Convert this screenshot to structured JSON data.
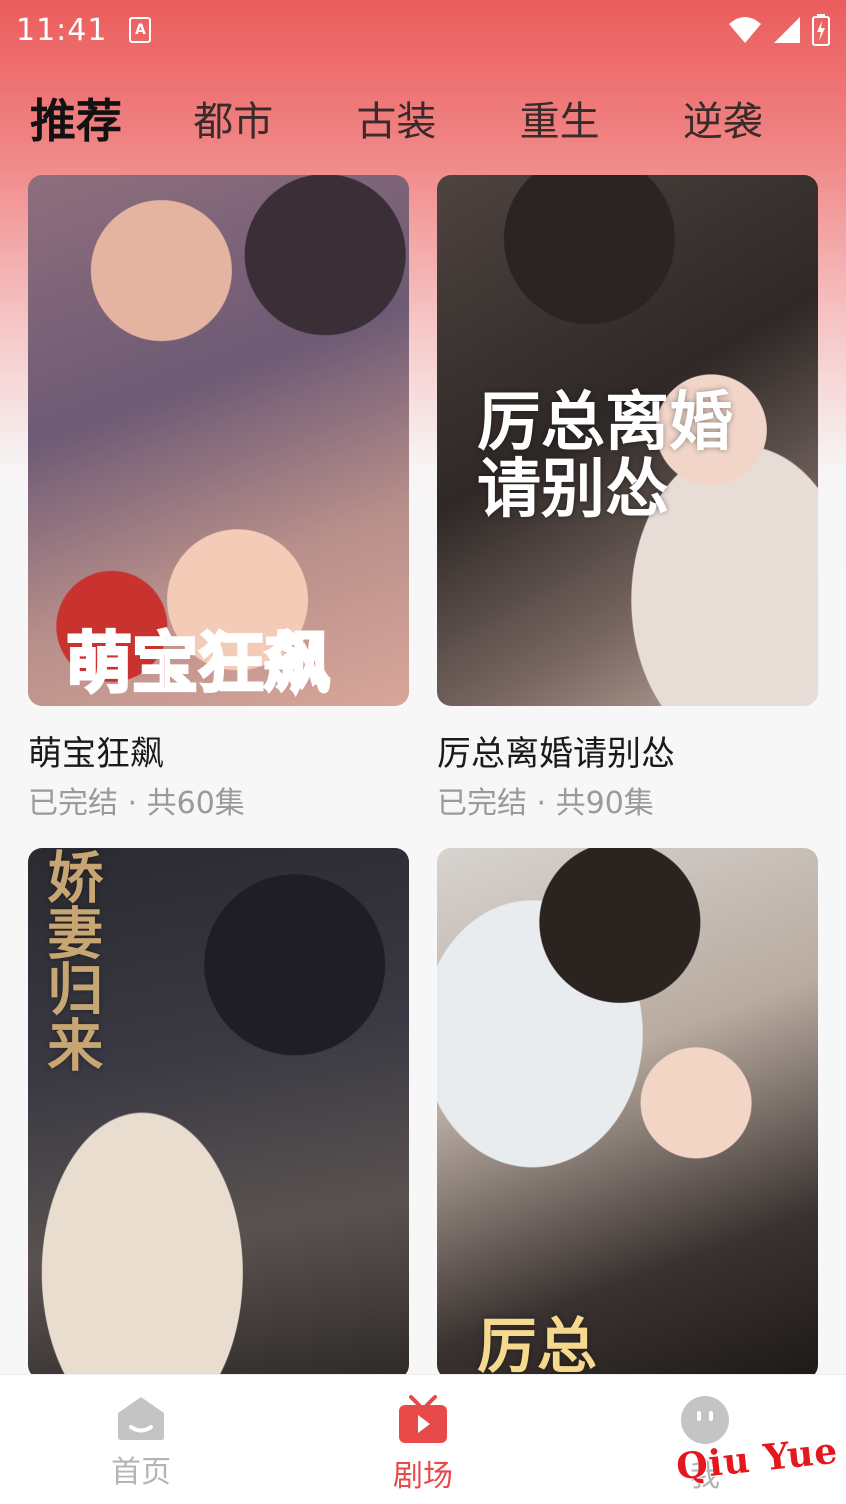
{
  "status_bar": {
    "time": "11:41",
    "app_badge": "A",
    "icons": [
      "wifi-icon",
      "signal-icon",
      "battery-charging-icon"
    ]
  },
  "tabs": [
    {
      "label": "推荐",
      "active": true
    },
    {
      "label": "都市",
      "active": false
    },
    {
      "label": "古装",
      "active": false
    },
    {
      "label": "重生",
      "active": false
    },
    {
      "label": "逆袭",
      "active": false
    }
  ],
  "dramas": [
    {
      "title": "萌宝狂飙",
      "meta": "已完结 · 共60集",
      "cover_text": "萌宝狂飙"
    },
    {
      "title": "厉总离婚请别怂",
      "meta": "已完结 · 共90集",
      "cover_text": "厉总离婚请别怂"
    },
    {
      "title": "",
      "meta": "",
      "cover_text": "娇妻归来"
    },
    {
      "title": "",
      "meta": "",
      "cover_text": "厉总"
    }
  ],
  "bottom_nav": [
    {
      "label": "首页",
      "icon": "home-icon",
      "active": false
    },
    {
      "label": "剧场",
      "icon": "tv-icon",
      "active": true
    },
    {
      "label": "我",
      "icon": "profile-icon",
      "active": false
    }
  ],
  "watermark": "Qiu  Yue",
  "colors": {
    "accent": "#e84a4a",
    "header_gradient_top": "#ec5c5c",
    "inactive": "#b5b5b5"
  }
}
